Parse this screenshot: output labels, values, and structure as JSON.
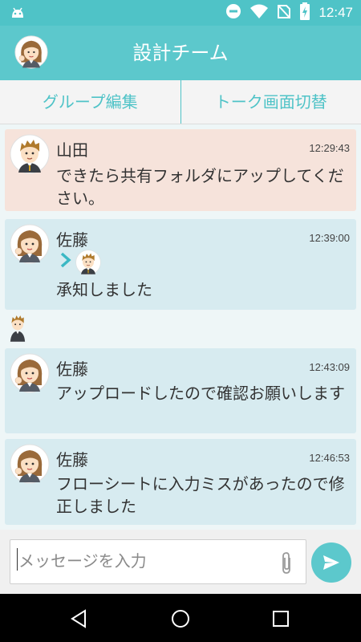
{
  "status_bar": {
    "time": "12:47"
  },
  "app_bar": {
    "title": "設計チーム"
  },
  "tabs": [
    {
      "label": "グループ編集"
    },
    {
      "label": "トーク画面切替"
    }
  ],
  "messages": [
    {
      "sender": "山田",
      "time": "12:29:43",
      "text": "できたら共有フォルダにアップしてください。",
      "bubble_color": "#f6e3db"
    },
    {
      "sender": "佐藤",
      "time": "12:39:00",
      "text": "承知しました",
      "bubble_color": "#d7ebf0",
      "reply_to": "山田"
    },
    {
      "sender": "佐藤",
      "time": "12:43:09",
      "text": "アップロードしたので確認お願いします",
      "bubble_color": "#d7ebf0"
    },
    {
      "sender": "佐藤",
      "time": "12:46:53",
      "text": "フローシートに入力ミスがあったので修正しました",
      "bubble_color": "#d7ebf0"
    }
  ],
  "composer": {
    "placeholder": "メッセージを入力"
  },
  "icons": {
    "status": [
      "android-icon",
      "do-not-disturb-icon",
      "wifi-icon",
      "no-sim-icon",
      "battery-charging-icon"
    ],
    "composer": [
      "paperclip-icon",
      "send-icon"
    ],
    "nav": [
      "back-icon",
      "home-icon",
      "recents-icon"
    ]
  },
  "colors": {
    "accent": "#5cc8cc",
    "pink_bubble": "#f6e3db",
    "blue_bubble": "#d7ebf0"
  }
}
